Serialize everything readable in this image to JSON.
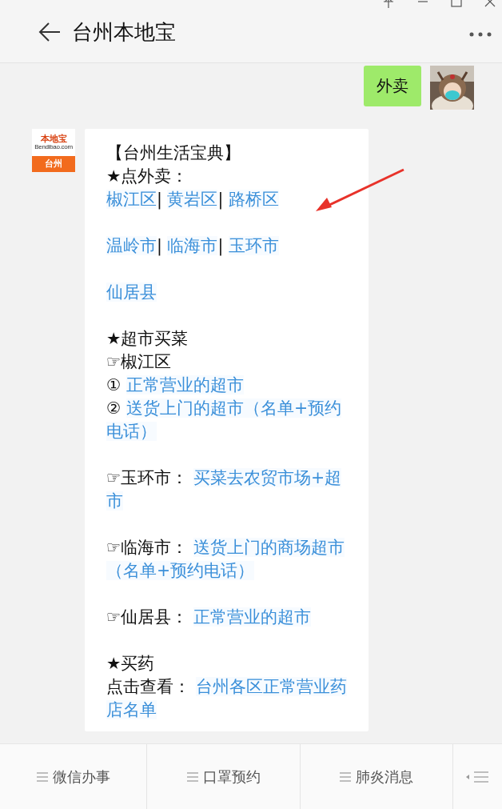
{
  "window": {
    "title": "台州本地宝"
  },
  "sent": {
    "text": "外卖"
  },
  "received": {
    "logo": {
      "brand": "本地宝",
      "site": "Bendibao.com",
      "city": "台州"
    },
    "paragraphs": [
      [
        [
          {
            "kind": "text",
            "text": "【台州生活宝典】"
          }
        ],
        [
          {
            "kind": "text",
            "text": "★点外卖："
          }
        ],
        [
          {
            "kind": "link",
            "text": "椒江区"
          },
          {
            "kind": "text",
            "text": "| "
          },
          {
            "kind": "link",
            "text": "黄岩区"
          },
          {
            "kind": "text",
            "text": "| "
          },
          {
            "kind": "link",
            "text": "路桥区"
          }
        ]
      ],
      [
        [
          {
            "kind": "link",
            "text": "温岭市"
          },
          {
            "kind": "text",
            "text": "| "
          },
          {
            "kind": "link",
            "text": "临海市"
          },
          {
            "kind": "text",
            "text": "| "
          },
          {
            "kind": "link",
            "text": "玉环市"
          }
        ]
      ],
      [
        [
          {
            "kind": "link",
            "text": "仙居县"
          }
        ]
      ],
      [
        [
          {
            "kind": "text",
            "text": "★超市买菜"
          }
        ],
        [
          {
            "kind": "text",
            "text": "☞椒江区"
          }
        ],
        [
          {
            "kind": "text",
            "text": "① "
          },
          {
            "kind": "link",
            "text": "正常营业的超市"
          }
        ],
        [
          {
            "kind": "text",
            "text": "② "
          },
          {
            "kind": "link",
            "text": "送货上门的超市（名单+预约"
          }
        ],
        [
          {
            "kind": "link",
            "text": "电话）"
          }
        ]
      ],
      [
        [
          {
            "kind": "text",
            "text": "☞玉环市： "
          },
          {
            "kind": "link",
            "text": "买菜去农贸市场+超"
          }
        ],
        [
          {
            "kind": "link",
            "text": "市"
          }
        ]
      ],
      [
        [
          {
            "kind": "text",
            "text": "☞临海市： "
          },
          {
            "kind": "link",
            "text": "送货上门的商场超市"
          }
        ],
        [
          {
            "kind": "link",
            "text": "（名单+预约电话）"
          }
        ]
      ],
      [
        [
          {
            "kind": "text",
            "text": "☞仙居县： "
          },
          {
            "kind": "link",
            "text": "正常营业的超市"
          }
        ]
      ],
      [
        [
          {
            "kind": "text",
            "text": "★买药"
          }
        ],
        [
          {
            "kind": "text",
            "text": "点击查看： "
          },
          {
            "kind": "link",
            "text": "台州各区正常营业药"
          }
        ],
        [
          {
            "kind": "link",
            "text": "店名单"
          }
        ]
      ]
    ]
  },
  "menu": [
    {
      "label": "微信办事"
    },
    {
      "label": "口罩预约"
    },
    {
      "label": "肺炎消息"
    }
  ]
}
